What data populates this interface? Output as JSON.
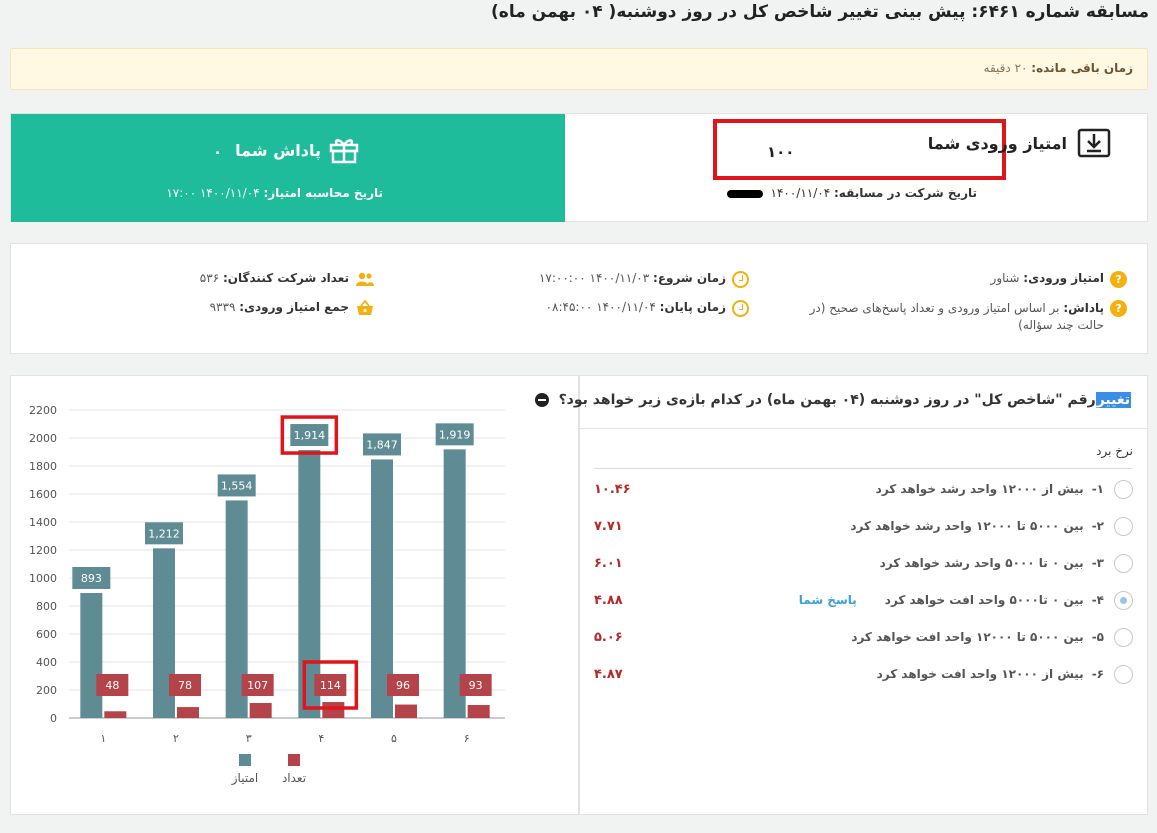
{
  "page_title": "مسابقه شماره ۶۴۶۱: پیش بینی تغییر شاخص کل در روز دوشنبه( ۰۴ بهمن ماه)",
  "alert": {
    "label": "زمان باقی مانده:",
    "value": "۲۰ دقیقه"
  },
  "reward": {
    "label": "پاداش شما",
    "value": "۰",
    "calc_label": "تاریخ محاسبه امتیاز:",
    "calc_value": "۱۴۰۰/۱۱/۰۴ ۱۷:۰۰"
  },
  "entry": {
    "label": "امتیاز ورودی شما",
    "value": "۱۰۰",
    "date_label": "تاریخ شرکت در مسابقه:",
    "date_value": "۱۴۰۰/۱۱/۰۴"
  },
  "info": {
    "entry_score_label": "امتیاز ورودی:",
    "entry_score_value": "شناور",
    "prize_label": "پاداش:",
    "prize_value": "بر اساس امتیاز ورودی و تعداد پاسخ‌های صحیح (در حالت چند سؤاله)",
    "start_label": "زمان شروع:",
    "start_value": "۱۴۰۰/۱۱/۰۳ ۱۷:۰۰:۰۰",
    "end_label": "زمان پایان:",
    "end_value": "۱۴۰۰/۱۱/۰۴ ۰۸:۴۵:۰۰",
    "participants_label": "تعداد شرکت کنندگان:",
    "participants_value": "۵۳۶",
    "total_label": "جمع امتیاز ورودی:",
    "total_value": "۹۳۳۹"
  },
  "question": {
    "highlight": "تغییر",
    "text": "رقم \"شاخص کل\" در روز دوشنبه (۰۴ بهمن ماه) در کدام بازه‌ی زیر خواهد بود؟",
    "rate_header": "نرخ برد",
    "options": [
      {
        "num": "۱-",
        "text": "بیش از ۱۲۰۰۰ واحد رشد خواهد کرد",
        "rate": "۱۰.۴۶",
        "selected": false,
        "badge": ""
      },
      {
        "num": "۲-",
        "text": "بین ۵۰۰۰ تا ۱۲۰۰۰ واحد رشد خواهد کرد",
        "rate": "۷.۷۱",
        "selected": false,
        "badge": ""
      },
      {
        "num": "۳-",
        "text": "بین ۰ تا ۵۰۰۰ واحد رشد خواهد کرد",
        "rate": "۶.۰۱",
        "selected": false,
        "badge": ""
      },
      {
        "num": "۴-",
        "text": "بین ۰ تا۵۰۰۰ واحد افت خواهد کرد",
        "rate": "۴.۸۸",
        "selected": true,
        "badge": "پاسخ شما"
      },
      {
        "num": "۵-",
        "text": "بین ۵۰۰۰ تا ۱۲۰۰۰ واحد افت خواهد کرد",
        "rate": "۵.۰۶",
        "selected": false,
        "badge": ""
      },
      {
        "num": "۶-",
        "text": "بیش از ۱۲۰۰۰ واحد افت خواهد کرد",
        "rate": "۴.۸۷",
        "selected": false,
        "badge": ""
      }
    ]
  },
  "colors": {
    "green": "#1ebc9a",
    "bar_score": "#5f8c94",
    "bar_count": "#b5434a",
    "highlight_red": "#e0141b"
  },
  "chart_data": {
    "type": "bar",
    "categories": [
      "۱",
      "۲",
      "۳",
      "۴",
      "۵",
      "۶"
    ],
    "series": [
      {
        "name": "امتیاز",
        "values": [
          893,
          1212,
          1554,
          1914,
          1847,
          1919
        ],
        "labels": [
          "893",
          "1,212",
          "1,554",
          "1,914",
          "1,847",
          "1,919"
        ]
      },
      {
        "name": "تعداد",
        "values": [
          48,
          78,
          107,
          114,
          96,
          93
        ],
        "labels": [
          "48",
          "78",
          "107",
          "114",
          "96",
          "93"
        ]
      }
    ],
    "yticks": [
      "0",
      "200",
      "400",
      "600",
      "800",
      "1000",
      "1200",
      "1400",
      "1600",
      "1800",
      "2000",
      "2200"
    ],
    "ylim": [
      0,
      2200
    ],
    "grid": true,
    "legend": "bottom",
    "highlighted_category": 3
  }
}
